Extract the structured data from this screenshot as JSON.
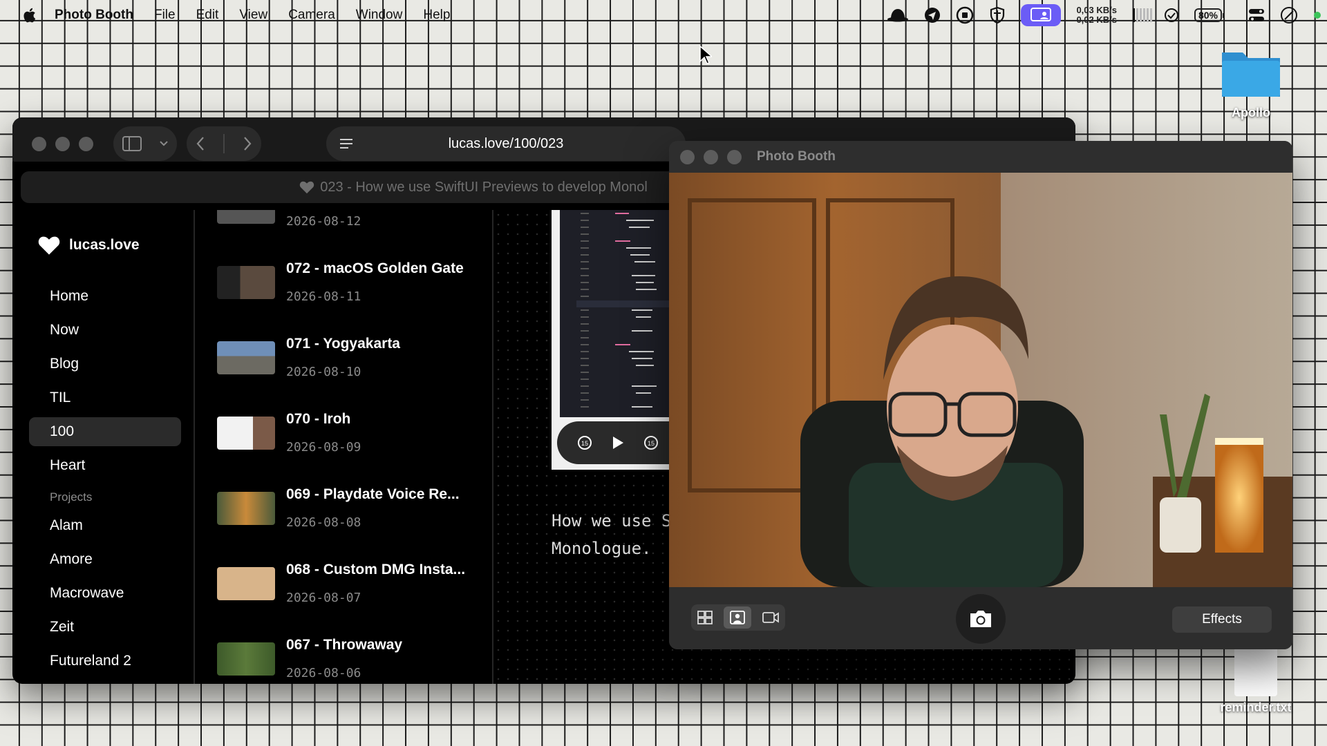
{
  "menubar": {
    "app_name": "Photo Booth",
    "items": [
      "File",
      "Edit",
      "View",
      "Camera",
      "Window",
      "Help"
    ],
    "status": {
      "net_up": "0,03 KB/s",
      "net_down": "0,02 KB/s",
      "battery": "80%"
    }
  },
  "desktop": {
    "folder_label": "Apollo",
    "file_label": "reminder.txt"
  },
  "browser": {
    "address": "lucas.love/100/023",
    "tab_title": "023 - How we use SwiftUI Previews to develop Monol",
    "brand": "lucas.love",
    "nav": [
      "Home",
      "Now",
      "Blog",
      "TIL",
      "100",
      "Heart"
    ],
    "active_nav": "100",
    "section_label": "Projects",
    "projects": [
      "Alam",
      "Amore",
      "Macrowave",
      "Zeit",
      "Futureland 2"
    ],
    "list": [
      {
        "title": "",
        "date": "2026-08-12"
      },
      {
        "title": "072 - macOS Golden Gate",
        "date": "2026-08-11"
      },
      {
        "title": "071 - Yogyakarta",
        "date": "2026-08-10"
      },
      {
        "title": "070 - Iroh",
        "date": "2026-08-09"
      },
      {
        "title": "069 - Playdate Voice Re...",
        "date": "2026-08-08"
      },
      {
        "title": "068 - Custom DMG Insta...",
        "date": "2026-08-07"
      },
      {
        "title": "067 - Throwaway",
        "date": "2026-08-06"
      }
    ],
    "description_line1": "How we use S",
    "description_line2": "Monologue."
  },
  "photobooth": {
    "title": "Photo Booth",
    "effects_label": "Effects"
  },
  "colors": {
    "accent_pill": "#6b5cf6",
    "browser_bg": "#000000",
    "folder_blue": "#3aa8e6"
  }
}
